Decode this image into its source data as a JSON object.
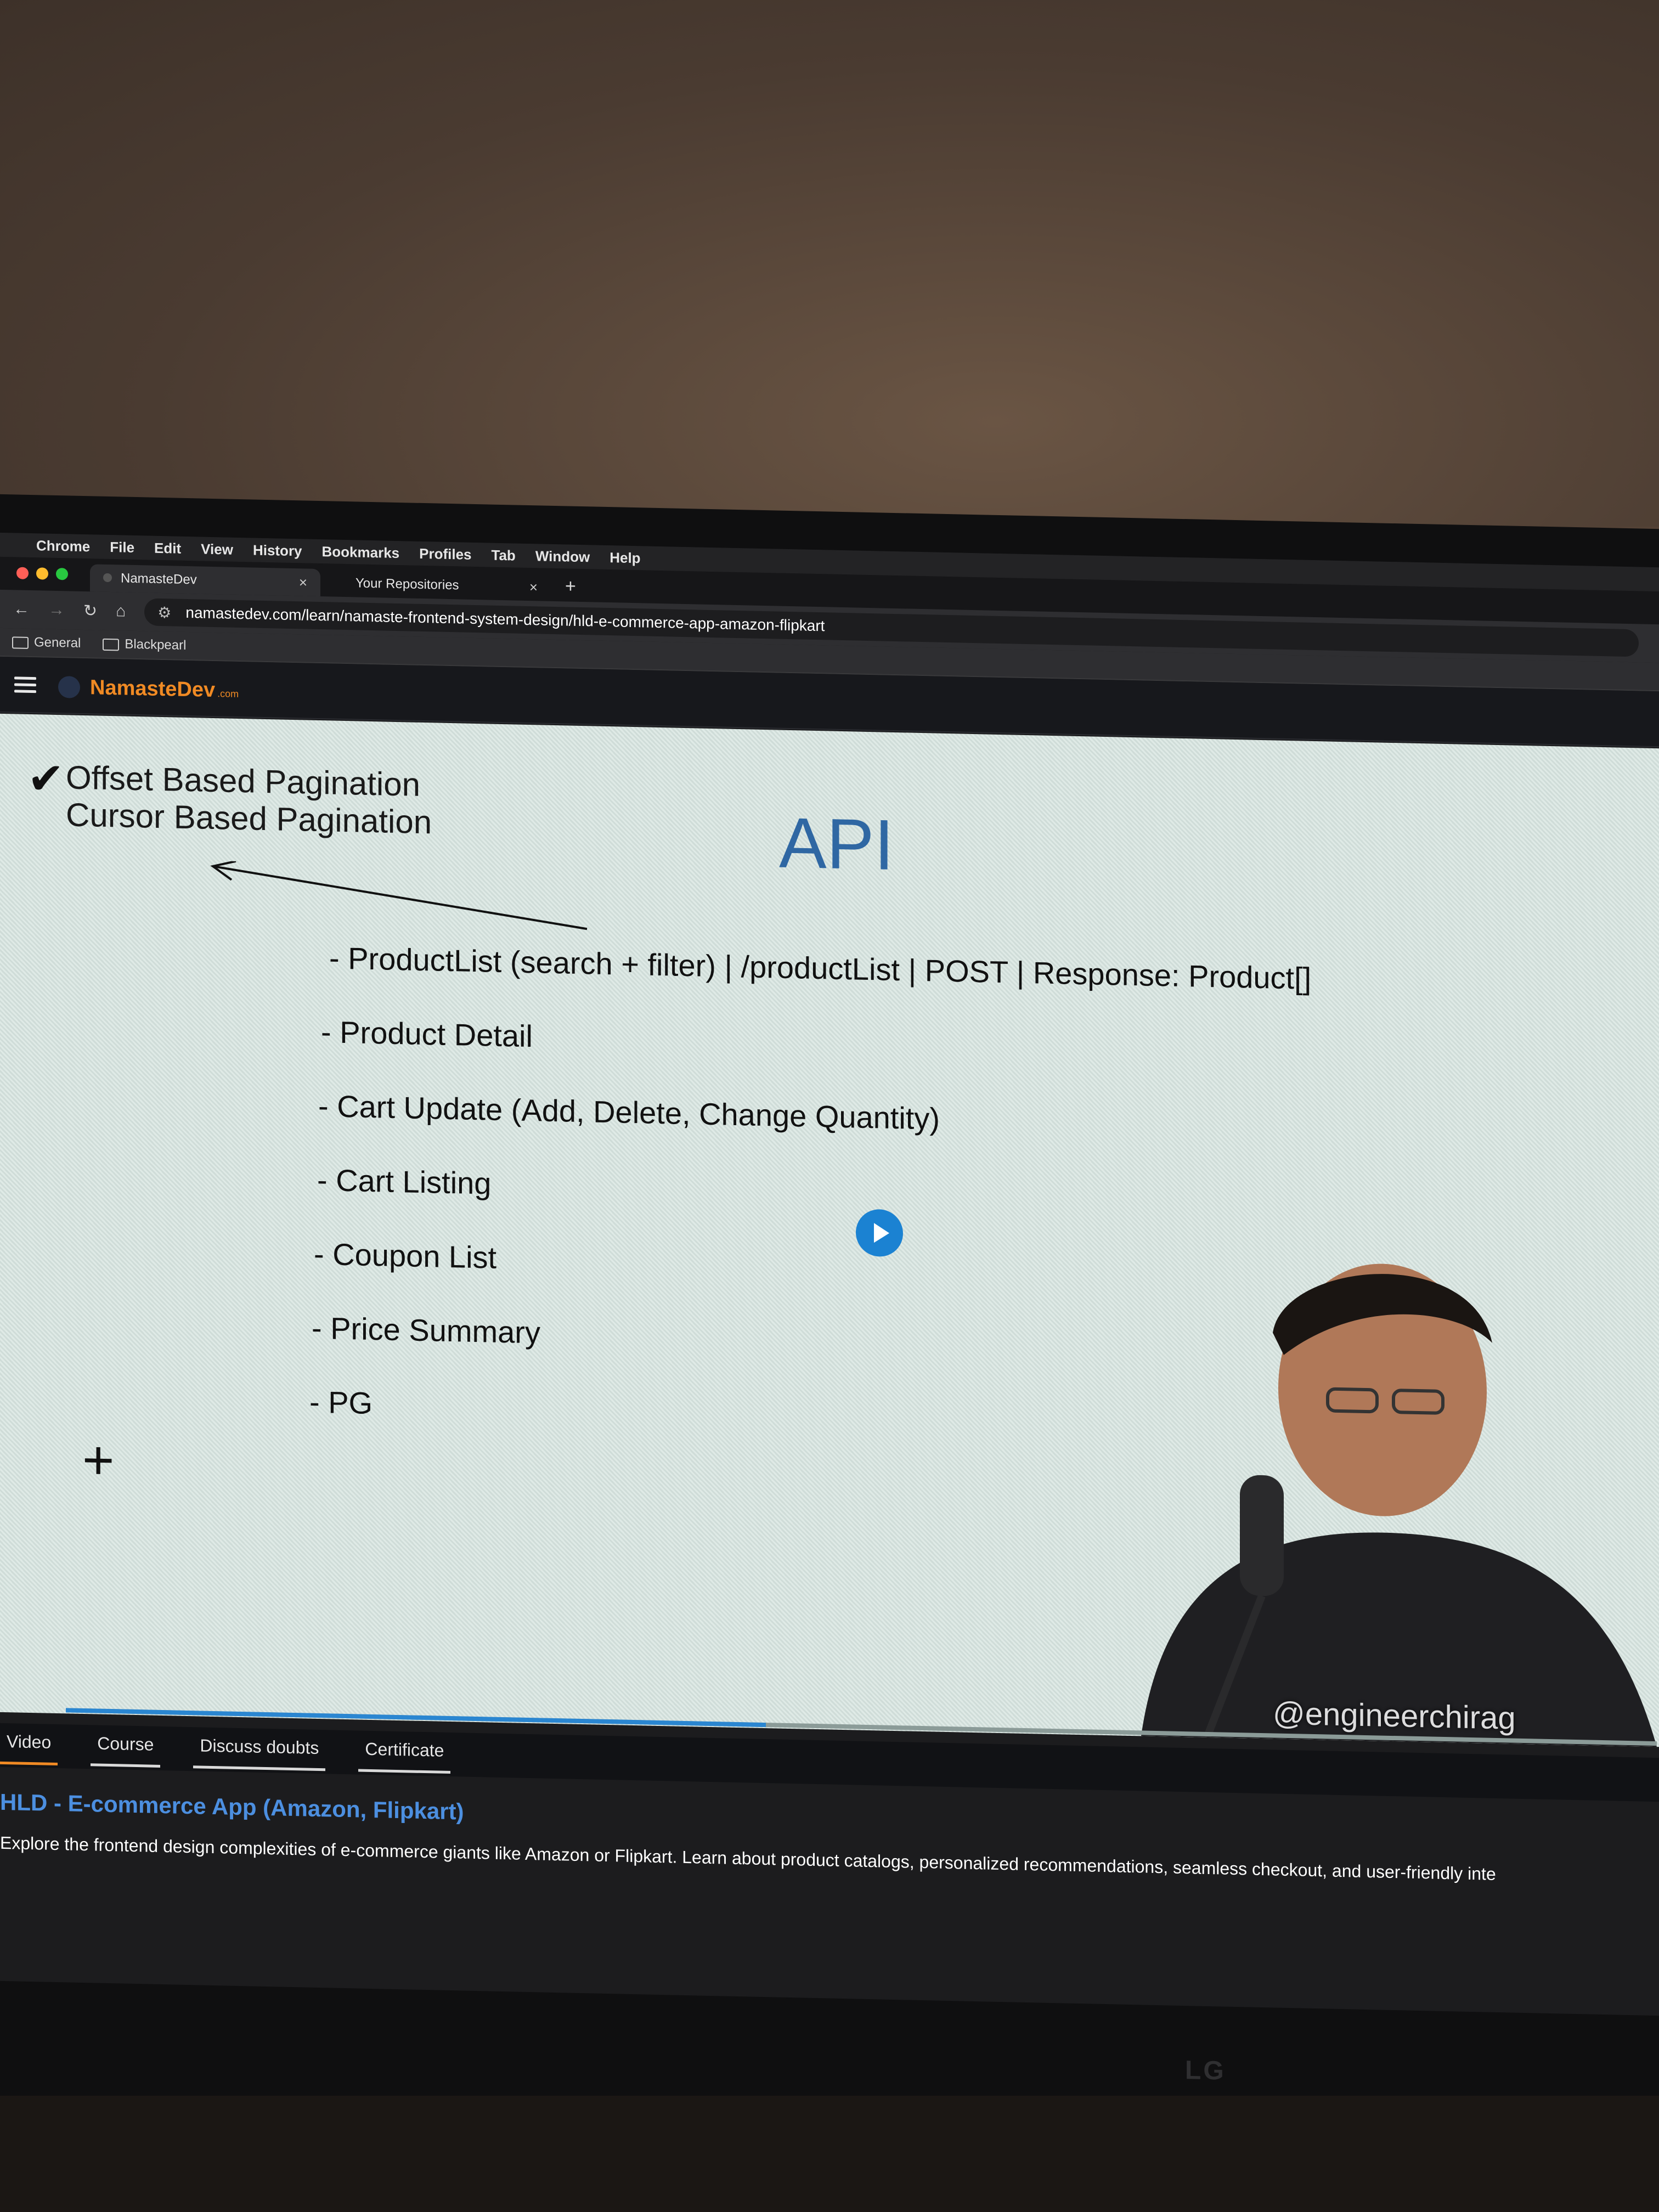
{
  "menubar": {
    "items": [
      "Chrome",
      "File",
      "Edit",
      "View",
      "History",
      "Bookmarks",
      "Profiles",
      "Tab",
      "Window",
      "Help"
    ]
  },
  "tabs": [
    {
      "title": "NamasteDev",
      "active": true
    },
    {
      "title": "Your Repositories",
      "active": false
    }
  ],
  "toolbar": {
    "url": "namastedev.com/learn/namaste-frontend-system-design/hld-e-commerce-app-amazon-flipkart"
  },
  "bookmarks": [
    "General",
    "Blackpearl"
  ],
  "site": {
    "brand": "NamasteDev",
    "brand_tld": ".com"
  },
  "slide": {
    "title": "API",
    "notes": [
      "Offset Based Pagination",
      "Cursor Based Pagination"
    ],
    "items": [
      "- ProductList (search + filter) | /productList | POST | Response: Product[]",
      "- Product Detail",
      "- Cart Update (Add, Delete, Change Quantity)",
      "- Cart Listing",
      "- Coupon List",
      "- Price Summary",
      "- PG"
    ],
    "watermark": "@engineerchirag"
  },
  "player": {
    "progress": 0.44
  },
  "page_tabs": [
    {
      "label": "Video",
      "active": true
    },
    {
      "label": "Course",
      "active": false
    },
    {
      "label": "Discuss doubts",
      "active": false
    },
    {
      "label": "Certificate",
      "active": false
    }
  ],
  "lesson": {
    "title": "HLD - E-commerce App (Amazon, Flipkart)",
    "description": "Explore the frontend design complexities of e-commerce giants like Amazon or Flipkart. Learn about product catalogs, personalized recommendations, seamless checkout, and user-friendly inte"
  },
  "monitor": {
    "brand": "LG"
  },
  "colors": {
    "accent": "#f08a24",
    "link": "#4c8fe0",
    "play": "#1b82d2"
  }
}
